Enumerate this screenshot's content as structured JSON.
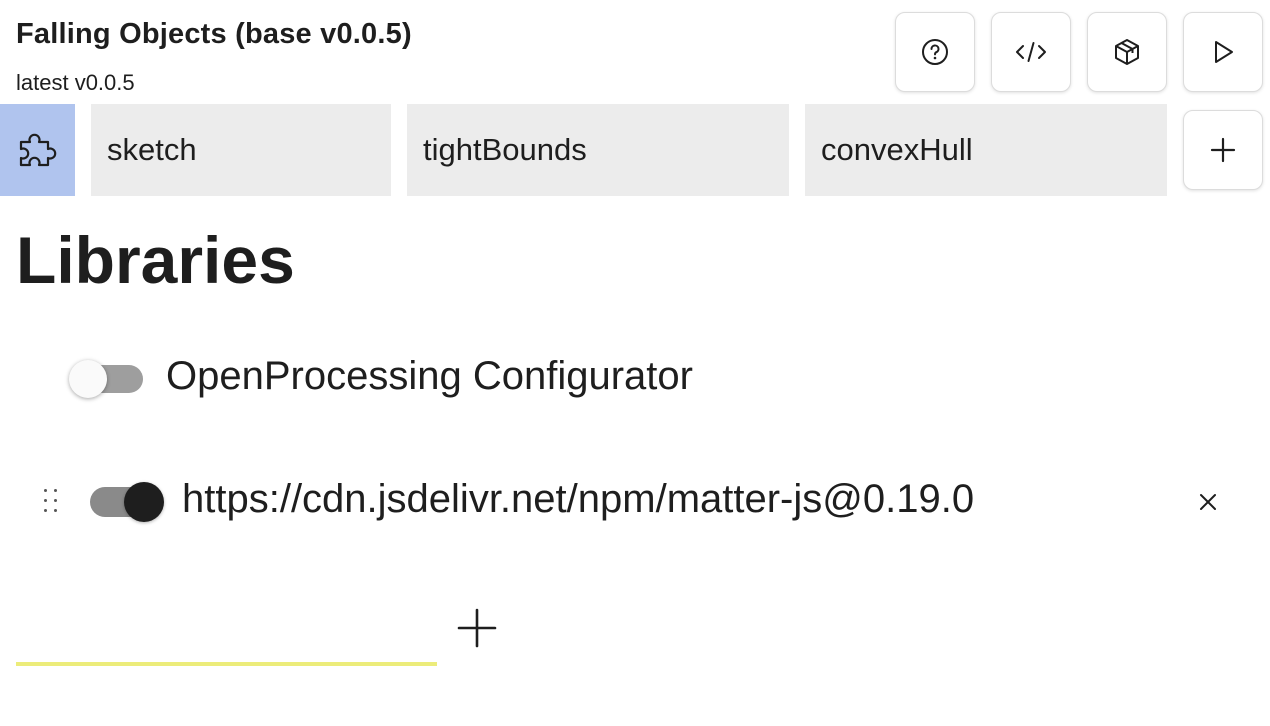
{
  "header": {
    "title": "Falling Objects (base v0.0.5)",
    "subtitle": "latest v0.0.5",
    "toolbar": [
      {
        "icon": "help-icon"
      },
      {
        "icon": "code-icon"
      },
      {
        "icon": "package-icon"
      },
      {
        "icon": "play-icon"
      }
    ]
  },
  "tabs": {
    "icon": "puzzle-icon",
    "active_color": "#b0c4ee",
    "items": [
      {
        "label": "sketch"
      },
      {
        "label": "tightBounds"
      },
      {
        "label": "convexHull"
      }
    ],
    "add_icon": "plus-icon"
  },
  "main": {
    "heading": "Libraries",
    "libraries": [
      {
        "label": "OpenProcessing Configurator",
        "enabled": false
      },
      {
        "label": "https://cdn.jsdelivr.net/npm/matter-js@0.19.0",
        "enabled": true,
        "removable": true
      }
    ],
    "new_library": {
      "value": "",
      "placeholder": ""
    },
    "input_underline_color": "#ecec7a"
  }
}
